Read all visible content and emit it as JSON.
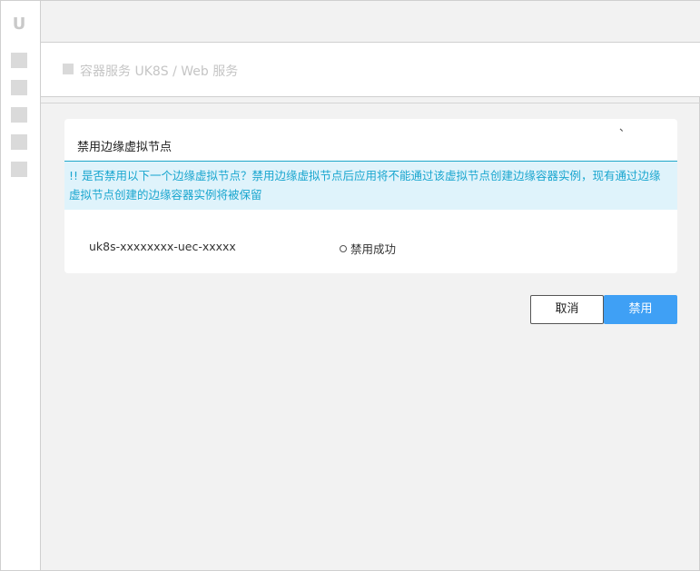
{
  "sidebar": {
    "logo": "U",
    "items": [
      "item-1",
      "item-2",
      "item-3",
      "item-4",
      "item-5"
    ]
  },
  "breadcrumb": {
    "text": "容器服务 UK8S / Web 服务"
  },
  "dialog": {
    "title": "禁用边缘虚拟节点",
    "close": "、",
    "alert": "!! 是否禁用以下一个边缘虚拟节点？禁用边缘虚拟节点后应用将不能通过该虚拟节点创建边缘容器实例，现有通过边缘虚拟节点创建的边缘容器实例将被保留",
    "node_name": "uk8s-xxxxxxxx-uec-xxxxx",
    "node_status": "禁用成功"
  },
  "buttons": {
    "cancel": "取消",
    "disable": "禁用"
  },
  "colors": {
    "primary": "#3fa0f5",
    "alert_text": "#1aa6cf",
    "alert_bg": "#dff3fb"
  }
}
